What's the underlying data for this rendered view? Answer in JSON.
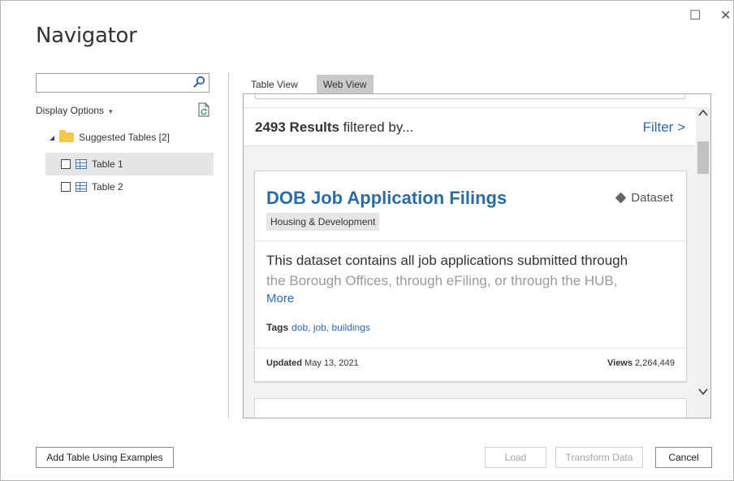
{
  "window": {
    "title": "Navigator",
    "maximize_glyph": "☐",
    "close_glyph": "✕"
  },
  "left_panel": {
    "search": {
      "value": "",
      "placeholder": "",
      "icon": "search-icon"
    },
    "display_options_label": "Display Options",
    "display_options_chevron": "▾",
    "tree": {
      "root_label": "Suggested Tables [2]",
      "items": [
        {
          "label": "Table 1",
          "selected": true,
          "checked": false
        },
        {
          "label": "Table 2",
          "selected": false,
          "checked": false
        }
      ]
    }
  },
  "right_panel": {
    "tabs": [
      {
        "label": "Table View",
        "active": false
      },
      {
        "label": "Web View",
        "active": true
      }
    ],
    "results_count": "2493 Results",
    "results_suffix": " filtered by...",
    "filter_label": "Filter >",
    "card": {
      "title": "DOB Job Application Filings",
      "type_label": "Dataset",
      "category": "Housing & Development",
      "description_line1": "This dataset contains all job applications submitted through",
      "description_line2": "the Borough Offices, through eFiling, or through the HUB,",
      "more_label": "More",
      "tags_label": "Tags",
      "tags_value": "dob, job, buildings",
      "updated_label": "Updated",
      "updated_value": " May 13, 2021",
      "views_label": "Views",
      "views_value": " 2,264,449"
    }
  },
  "buttons": {
    "add_table": "Add Table Using Examples",
    "load": "Load",
    "transform": "Transform Data",
    "cancel": "Cancel"
  },
  "colors": {
    "link": "#2b6cb0",
    "title_link": "#2b6ca3",
    "folder": "#f2c94c",
    "tab_active": "#c9c9c9"
  }
}
